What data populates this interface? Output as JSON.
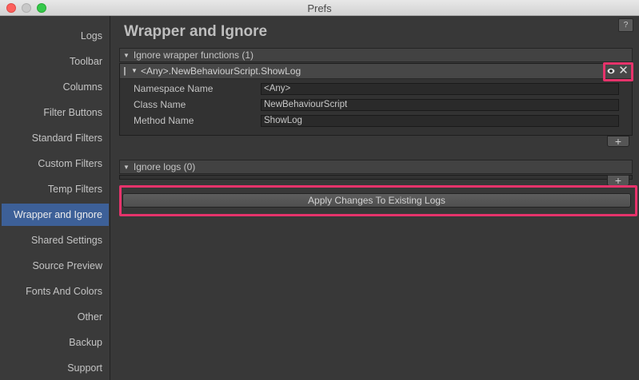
{
  "window": {
    "title": "Prefs"
  },
  "sidebar": {
    "items": [
      {
        "label": "Logs"
      },
      {
        "label": "Toolbar"
      },
      {
        "label": "Columns"
      },
      {
        "label": "Filter Buttons"
      },
      {
        "label": "Standard Filters"
      },
      {
        "label": "Custom Filters"
      },
      {
        "label": "Temp Filters"
      },
      {
        "label": "Wrapper and Ignore"
      },
      {
        "label": "Shared Settings"
      },
      {
        "label": "Source Preview"
      },
      {
        "label": "Fonts And Colors"
      },
      {
        "label": "Other"
      },
      {
        "label": "Backup"
      },
      {
        "label": "Support"
      }
    ],
    "active_index": 7
  },
  "main": {
    "title": "Wrapper and Ignore",
    "help_label": "?",
    "wrapper_section": {
      "header": "Ignore wrapper functions (1)",
      "entry": {
        "label": "<Any>.NewBehaviourScript.ShowLog",
        "fields": [
          {
            "label": "Namespace Name",
            "value": "<Any>"
          },
          {
            "label": "Class Name",
            "value": "NewBehaviourScript"
          },
          {
            "label": "Method Name",
            "value": "ShowLog"
          }
        ]
      },
      "add_label": "+"
    },
    "ignore_section": {
      "header": "Ignore logs (0)",
      "add_label": "+"
    },
    "apply_button": "Apply Changes To Existing Logs"
  },
  "colors": {
    "highlight": "#e6336b",
    "active_item": "#3d6098",
    "background": "#383838"
  },
  "icons": [
    "eye-icon",
    "close-icon",
    "drag-handle-icon",
    "foldout-arrow-icon",
    "plus-icon",
    "help-icon"
  ]
}
